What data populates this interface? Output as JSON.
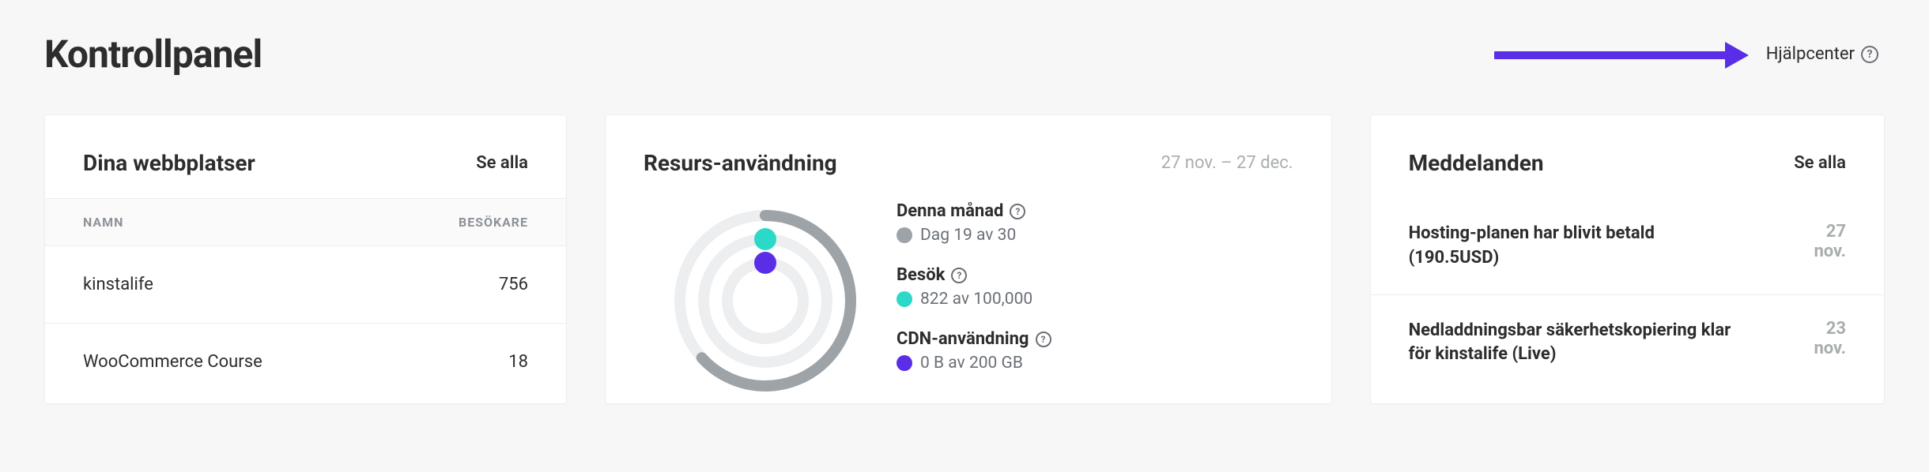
{
  "page_title": "Kontrollpanel",
  "help_link_label": "Hjälpcenter",
  "sites_card": {
    "title": "Dina webbplatser",
    "see_all": "Se alla",
    "col_name": "Namn",
    "col_visitors": "Besökare",
    "rows": [
      {
        "name": "kinstalife",
        "visitors": "756"
      },
      {
        "name": "WooCommerce Course",
        "visitors": "18"
      }
    ]
  },
  "usage_card": {
    "title": "Resurs-användning",
    "date_range": "27 nov. – 27 dec.",
    "month_label": "Denna månad",
    "month_value": "Dag 19 av 30",
    "visits_label": "Besök",
    "visits_value": "822 av 100,000",
    "cdn_label": "CDN-användning",
    "cdn_value": "0 B av 200 GB",
    "colors": {
      "month": "#9ea3a8",
      "visits": "#2bd9c9",
      "cdn": "#5a2ee6"
    }
  },
  "messages_card": {
    "title": "Meddelanden",
    "see_all": "Se alla",
    "items": [
      {
        "text": "Hosting-planen har blivit betald (190.5USD)",
        "day": "27",
        "month": "nov."
      },
      {
        "text": "Nedladdningsbar säkerhetskopiering klar för kinstalife (Live)",
        "day": "23",
        "month": "nov."
      }
    ]
  },
  "chart_data": {
    "type": "pie",
    "title": "Resurs-användning",
    "series": [
      {
        "name": "Denna månad",
        "value": 19,
        "max": 30,
        "percent": 63.3,
        "color": "#9ea3a8"
      },
      {
        "name": "Besök",
        "value": 822,
        "max": 100000,
        "percent": 0.822,
        "color": "#2bd9c9"
      },
      {
        "name": "CDN-användning",
        "value": 0,
        "max": 200,
        "unit": "GB",
        "percent": 0,
        "color": "#5a2ee6"
      }
    ]
  }
}
